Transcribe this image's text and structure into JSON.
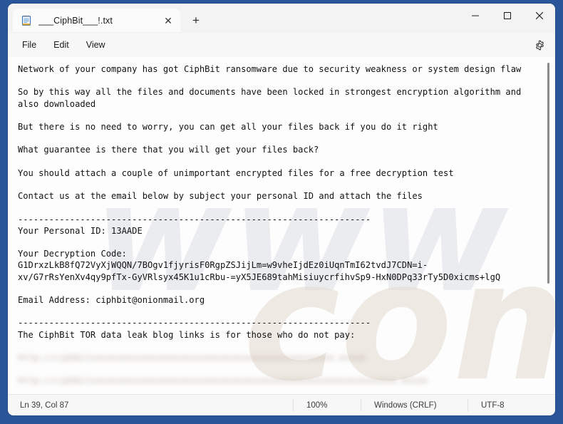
{
  "window": {
    "frame_color": "#2a5699",
    "controls": {
      "minimize_label": "─",
      "maximize_label": "□",
      "close_label": "✕"
    }
  },
  "tab": {
    "icon": "notepad-icon",
    "title": "___CiphBit___!.txt",
    "close_label": "✕",
    "new_tab_label": "+"
  },
  "menubar": {
    "items": [
      {
        "label": "File"
      },
      {
        "label": "Edit"
      },
      {
        "label": "View"
      }
    ],
    "settings_icon": "gear-icon"
  },
  "editor": {
    "lines": [
      {
        "text": "Network of your company has got CiphBit ransomware due to security weakness or system design flaw",
        "blurred": false
      },
      {
        "text": "",
        "blurred": false
      },
      {
        "text": "So by this way all the files and documents have been locked in strongest encryption algorithm and",
        "blurred": false
      },
      {
        "text": "also downloaded",
        "blurred": false
      },
      {
        "text": "",
        "blurred": false
      },
      {
        "text": "But there is no need to worry, you can get all your files back if you do it right",
        "blurred": false
      },
      {
        "text": "",
        "blurred": false
      },
      {
        "text": "What guarantee is there that you will get your files back?",
        "blurred": false
      },
      {
        "text": "",
        "blurred": false
      },
      {
        "text": "You should attach a couple of unimportant encrypted files for a free decryption test",
        "blurred": false
      },
      {
        "text": "",
        "blurred": false
      },
      {
        "text": "Contact us at the email below by subject your personal ID and attach the files",
        "blurred": false
      },
      {
        "text": "",
        "blurred": false
      },
      {
        "text": "--------------------------------------------------------------------",
        "blurred": false
      },
      {
        "text": "Your Personal ID: 13AADE",
        "blurred": false
      },
      {
        "text": "",
        "blurred": false
      },
      {
        "text": "Your Decryption Code:",
        "blurred": false
      },
      {
        "text": "G1DrxzLkB8fQ72VyXjWQQN/7BOgv1fjyrisF0RgpZSJijLm=w9vheIjdEz0iUqnTmI62tvdJ7CDN=i-",
        "blurred": false
      },
      {
        "text": "xv/G7rRsYenXv4qy9pfTx-GyVRlsyx45K1u1cRbu-=yX5JE689tahMisiuycrfihvSp9-HxN0DPq33rTy5D0xicms+lgQ",
        "blurred": false
      },
      {
        "text": "",
        "blurred": false
      },
      {
        "text": "Email Address: ciphbit@onionmail.org",
        "blurred": false
      },
      {
        "text": "",
        "blurred": false
      },
      {
        "text": "--------------------------------------------------------------------",
        "blurred": false
      },
      {
        "text": "The CiphBit TOR data leak blog links is for those who do not pay:",
        "blurred": false
      },
      {
        "text": "",
        "blurred": false
      },
      {
        "text": "http://ciphbitxxxxxxxxxxxxxxxxxxxxxxxxxxxxxxxxxxxxxxxxxxxxxxx.onion",
        "blurred": true
      },
      {
        "text": "",
        "blurred": false
      },
      {
        "text": "http://ciphbitxxxxxxxxxxxxxxxxxxxxxxxxxxxxxxxxxxxxxxxxxxxxxxxxxxxxxxxxxxx.onion",
        "blurred": true
      }
    ]
  },
  "statusbar": {
    "cursor_position": "Ln 39, Col 87",
    "zoom": "100%",
    "line_ending": "Windows (CRLF)",
    "encoding": "UTF-8"
  },
  "watermark": {
    "beige_text": "com",
    "grey_text": "www"
  }
}
